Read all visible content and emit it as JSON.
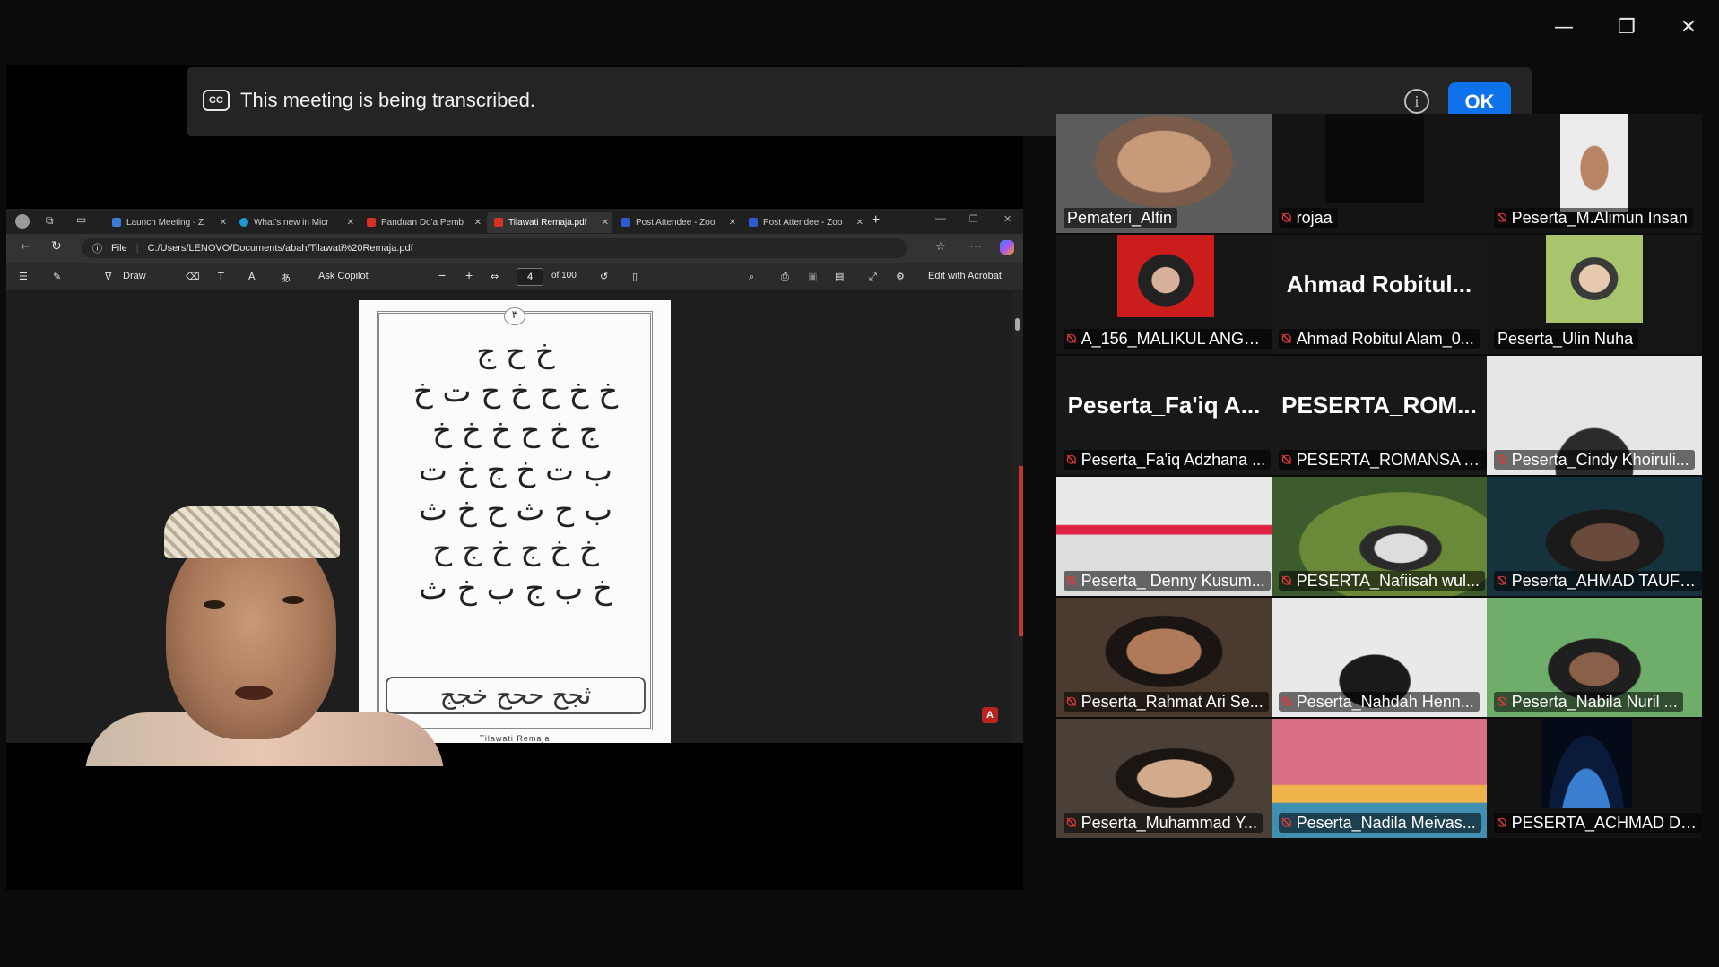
{
  "window_controls": {
    "minimize": "—",
    "restore": "❐",
    "close": "✕"
  },
  "banner": {
    "cc_label": "CC",
    "message": "This meeting is being transcribed.",
    "info_glyph": "i",
    "ok_label": "OK"
  },
  "browser": {
    "tabs": [
      {
        "label": "Launch Meeting - Z",
        "color": "#3a7bd5"
      },
      {
        "label": "What's new in Micr",
        "color": "#1d9bd1"
      },
      {
        "label": "Panduan Do'a Pemb",
        "color": "#d93025"
      },
      {
        "label": "Tilawati Remaja.pdf",
        "color": "#d93025"
      },
      {
        "label": "Post Attendee - Zoo",
        "color": "#2d5bd3"
      },
      {
        "label": "Post Attendee - Zoo",
        "color": "#2d5bd3"
      }
    ],
    "address_prefix": "File",
    "address": "C:/Users/LENOVO/Documents/abah/Tilawati%20Remaja.pdf",
    "pdf_toolbar": {
      "draw": "Draw",
      "ask_copilot": "Ask Copilot",
      "page": "4",
      "page_total": "of 100",
      "edit_acrobat": "Edit with Acrobat"
    },
    "pdf_page": {
      "page_marker": "٣",
      "rows": [
        "خ ح ج",
        "خ خ ح خ ح ت خ",
        "ج خ ح خ خ خ",
        "ب ت خ ج خ ت",
        "ب ح ث ح خ ث",
        "خ خ ج خ ج ح",
        "خ ب ج ب خ ث"
      ],
      "box_text": "ثجح ححح خجج",
      "footer": "Tilawati Remaja"
    }
  },
  "participants": [
    {
      "name": "Pemateri_Alfin",
      "muted": false,
      "active": true
    },
    {
      "name": "rojaa",
      "muted": true
    },
    {
      "name": "Peserta_M.Alimun Insan",
      "muted": true
    },
    {
      "name": "A_156_MALIKUL ANGG...",
      "muted": true
    },
    {
      "name": "Ahmad Robitul Alam_0...",
      "muted": true,
      "big_label": "Ahmad  Robitul..."
    },
    {
      "name": "Peserta_Ulin Nuha",
      "muted": false
    },
    {
      "name": "Peserta_Fa'iq Adzhana ...",
      "muted": true,
      "big_label": "Peserta_Fa'iq  A..."
    },
    {
      "name": "PESERTA_ROMANSA A...",
      "muted": true,
      "big_label": "PESERTA_ROM..."
    },
    {
      "name": "Peserta_Cindy Khoiruli...",
      "muted": true
    },
    {
      "name": "Peserta_ Denny Kusum...",
      "muted": true
    },
    {
      "name": "PESERTA_Nafiisah wul...",
      "muted": true
    },
    {
      "name": "Peserta_AHMAD TAUFI...",
      "muted": true
    },
    {
      "name": "Peserta_Rahmat Ari Se...",
      "muted": true
    },
    {
      "name": "Peserta_Nahdah Henn...",
      "muted": true
    },
    {
      "name": "Peserta_Nabila Nuril ...",
      "muted": true
    },
    {
      "name": "Peserta_Muhammad Y...",
      "muted": true
    },
    {
      "name": "Peserta_Nadila Meivas...",
      "muted": true
    },
    {
      "name": "PESERTA_ACHMAD DA...",
      "muted": true
    }
  ],
  "mute_icon": "mic-muted-icon",
  "colors": {
    "accent": "#0e72ed",
    "active_speaker": "#23d959",
    "muted": "#e03a3a"
  }
}
